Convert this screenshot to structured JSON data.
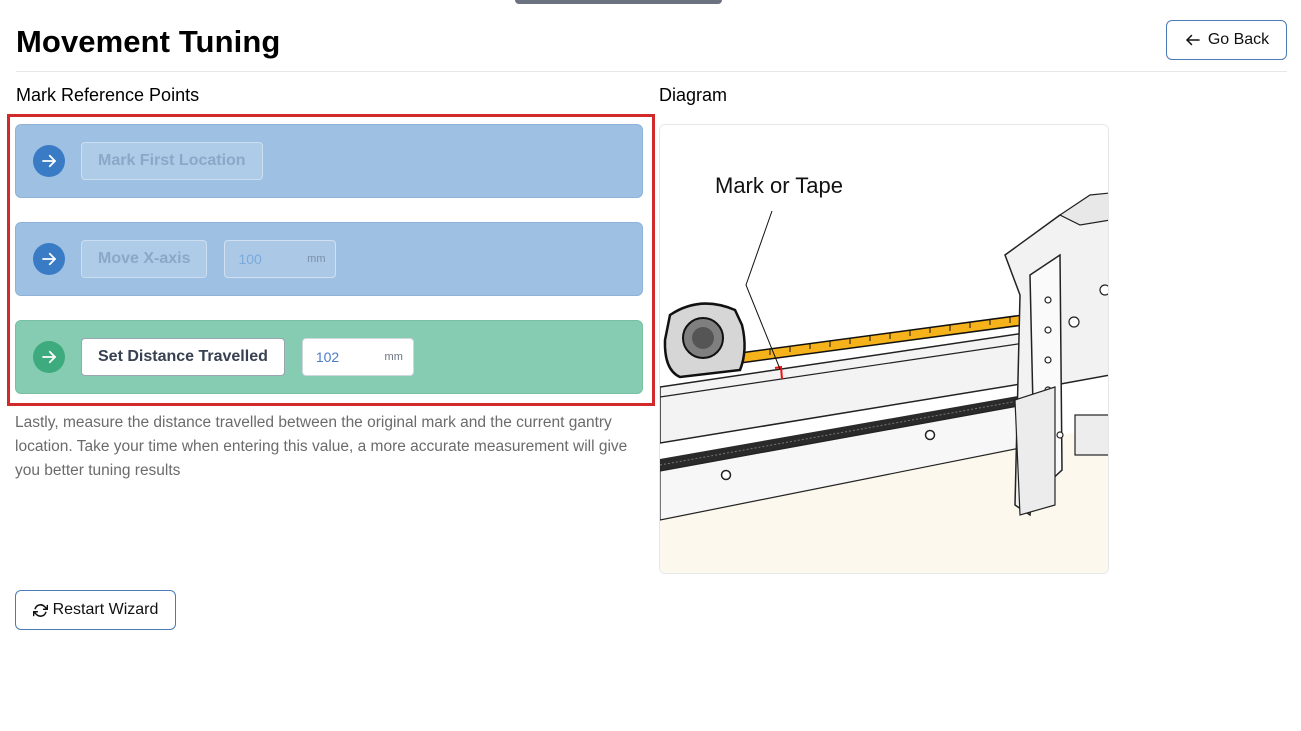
{
  "page": {
    "title": "Movement Tuning",
    "go_back_label": "Go Back",
    "restart_label": "Restart Wizard"
  },
  "left": {
    "section_title": "Mark Reference Points",
    "steps": [
      {
        "button_label": "Mark First Location",
        "state": "disabled"
      },
      {
        "button_label": "Move X-axis",
        "state": "disabled",
        "input_value": "100",
        "unit": "mm"
      },
      {
        "button_label": "Set Distance Travelled",
        "state": "active",
        "input_value": "102",
        "unit": "mm"
      }
    ],
    "instructions": "Lastly, measure the distance travelled between the original mark and the current gantry location. Take your time when entering this value, a more accurate measurement will give you better tuning results"
  },
  "right": {
    "section_title": "Diagram",
    "diagram_label": "Mark or Tape"
  },
  "icons": {
    "go_back": "arrow-left-icon",
    "step": "arrow-right-circle-icon",
    "restart": "refresh-icon"
  },
  "colors": {
    "step_blue": "#9dc0e3",
    "step_green": "#86ccb2",
    "highlight": "#d22a2a",
    "button_border": "#4a7bb7"
  }
}
